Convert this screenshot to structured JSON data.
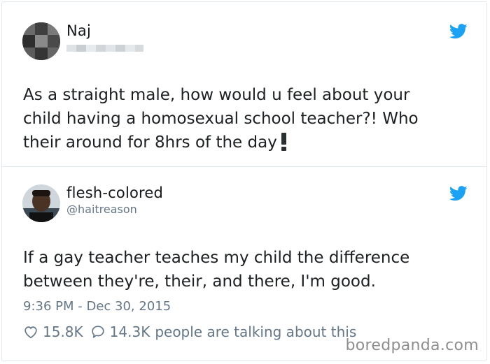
{
  "colors": {
    "twitter_blue": "#1da1f2",
    "text": "#1c2022",
    "muted": "#657786",
    "border": "#e1e8ed"
  },
  "tweet1": {
    "author_name": "Naj",
    "handle_blurred": true,
    "text_lines": [
      "As a straight male, how would u feel about your",
      "child having a homosexual school teacher?! Who",
      "their around for 8hrs of the day"
    ],
    "trailing_icon": "exclamation-emoji-icon",
    "brand_icon": "twitter-bird-icon"
  },
  "tweet2": {
    "author_name": "flesh-colored",
    "handle": "@haitreason",
    "text_lines": [
      "If a gay teacher teaches my child the difference",
      "between they're, their, and there, I'm good."
    ],
    "timestamp": "9:36 PM - Dec 30, 2015",
    "likes": "15.8K",
    "replies": "14.3K",
    "replies_suffix": "people are talking about this",
    "like_icon": "heart-icon",
    "reply_icon": "speech-bubble-icon",
    "brand_icon": "twitter-bird-icon"
  },
  "watermark": "boredpanda.com"
}
